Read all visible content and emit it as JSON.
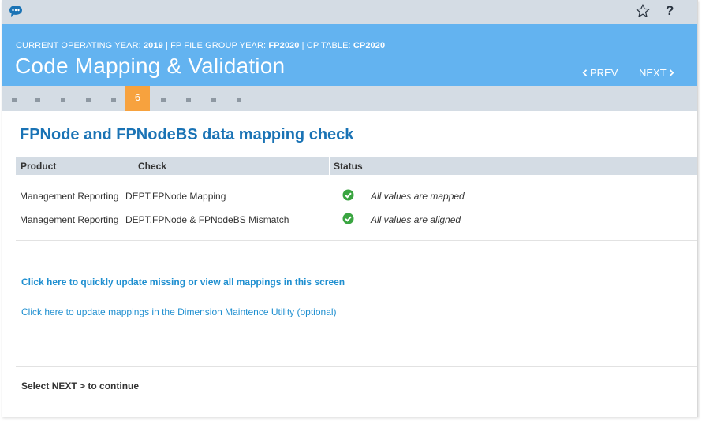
{
  "topbar": {
    "chat_icon": "chat-bubble-icon",
    "star_icon": "star-icon",
    "help_label": "?"
  },
  "header": {
    "meta": {
      "year_label": "CURRENT OPERATING YEAR: ",
      "year_value": "2019",
      "group_label": " | FP FILE GROUP YEAR: ",
      "group_value": "FP2020",
      "table_label": " | CP TABLE: ",
      "table_value": "CP2020"
    },
    "title": "Code Mapping & Validation",
    "prev_label": "PREV",
    "next_label": "NEXT"
  },
  "steps": {
    "active_label": "6",
    "active_color": "#f7a23e"
  },
  "main": {
    "title": "FPNode and FPNodeBS data mapping check",
    "columns": [
      "Product",
      "Check",
      "Status"
    ],
    "rows": [
      {
        "product": "Management Reporting",
        "check": "DEPT.FPNode Mapping",
        "status": "ok",
        "result": "All values are mapped"
      },
      {
        "product": "Management Reporting",
        "check": "DEPT.FPNode & FPNodeBS Mismatch",
        "status": "ok",
        "result": "All values are aligned"
      }
    ],
    "link_update": "Click here to quickly update missing or view all mappings in this screen",
    "link_utility": "Click here to update mappings in the Dimension Maintence Utility (optional)",
    "footer": "Select NEXT > to continue"
  },
  "colors": {
    "header": "#63b3f0",
    "bar": "#d4dce4",
    "title": "#1a73b5",
    "link": "#1f8fd0",
    "success": "#3aa541"
  }
}
